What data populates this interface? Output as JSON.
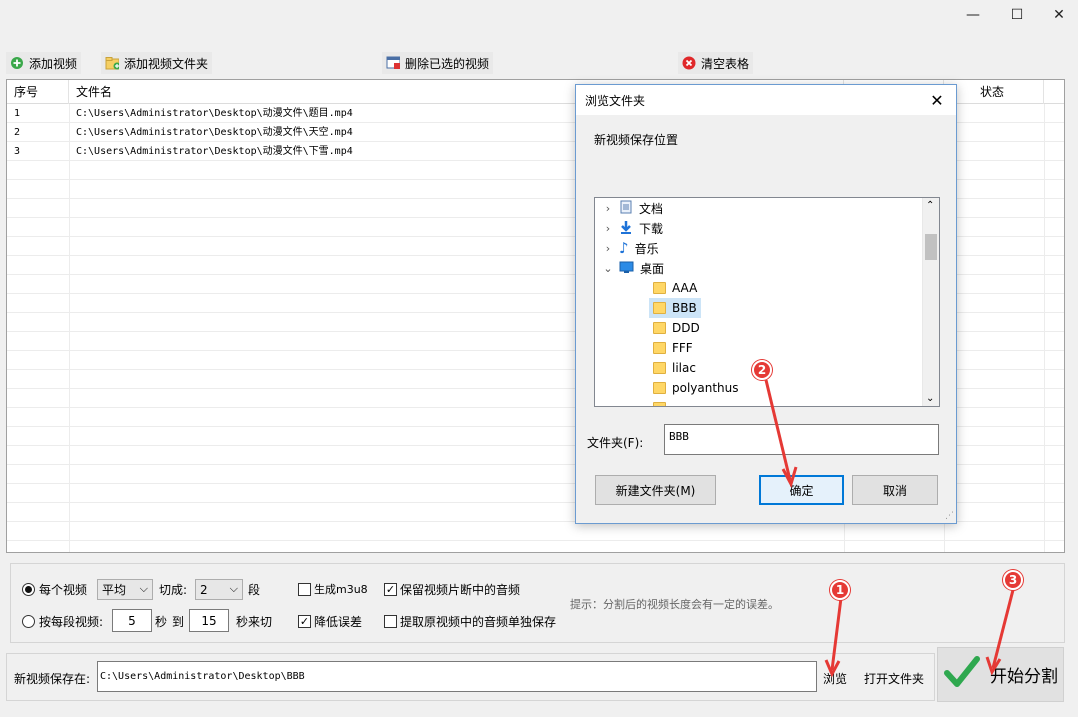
{
  "window": {
    "minimize": "—",
    "maximize": "☐",
    "close": "✕"
  },
  "toolbar": {
    "add_video": "添加视频",
    "add_folder": "添加视频文件夹",
    "delete_selected": "删除已选的视频",
    "clear_table": "清空表格"
  },
  "table": {
    "headers": {
      "index": "序号",
      "filename": "文件名",
      "status": "状态"
    },
    "rows": [
      {
        "index": "1",
        "filename": "C:\\Users\\Administrator\\Desktop\\动漫文件\\题目.mp4"
      },
      {
        "index": "2",
        "filename": "C:\\Users\\Administrator\\Desktop\\动漫文件\\天空.mp4"
      },
      {
        "index": "3",
        "filename": "C:\\Users\\Administrator\\Desktop\\动漫文件\\下雪.mp4"
      }
    ]
  },
  "options": {
    "per_video_label": "每个视频",
    "mode_select": "平均",
    "cut_into_label": "切成:",
    "segments_select": "2",
    "segments_unit": "段",
    "gen_m3u8": "生成m3u8",
    "keep_audio": "保留视频片断中的音频",
    "per_segment_label": "按每段视频:",
    "from_seconds": "5",
    "seconds_unit": "秒",
    "to_label": "到",
    "to_seconds": "15",
    "cut_suffix": "秒来切",
    "reduce_error": "降低误差",
    "extract_audio": "提取原视频中的音频单独保存",
    "hint": "提示：分割后的视频长度会有一定的误差。"
  },
  "save": {
    "label": "新视频保存在:",
    "path": "C:\\Users\\Administrator\\Desktop\\BBB",
    "browse": "浏览",
    "open_folder": "打开文件夹",
    "start": "开始分割"
  },
  "dialog": {
    "title": "浏览文件夹",
    "description": "新视频保存位置",
    "tree": {
      "documents": "文档",
      "downloads": "下载",
      "music": "音乐",
      "desktop": "桌面",
      "folders": [
        "AAA",
        "BBB",
        "DDD",
        "FFF",
        "lilac",
        "polyanthus"
      ]
    },
    "folder_label": "文件夹(F):",
    "folder_value": "BBB",
    "new_folder": "新建文件夹(M)",
    "ok": "确定",
    "cancel": "取消"
  },
  "markers": {
    "m1": "1",
    "m2": "2",
    "m3": "3"
  },
  "colors": {
    "accent": "#0078d7",
    "marker": "#e53935",
    "start_check": "#2fa84f"
  }
}
